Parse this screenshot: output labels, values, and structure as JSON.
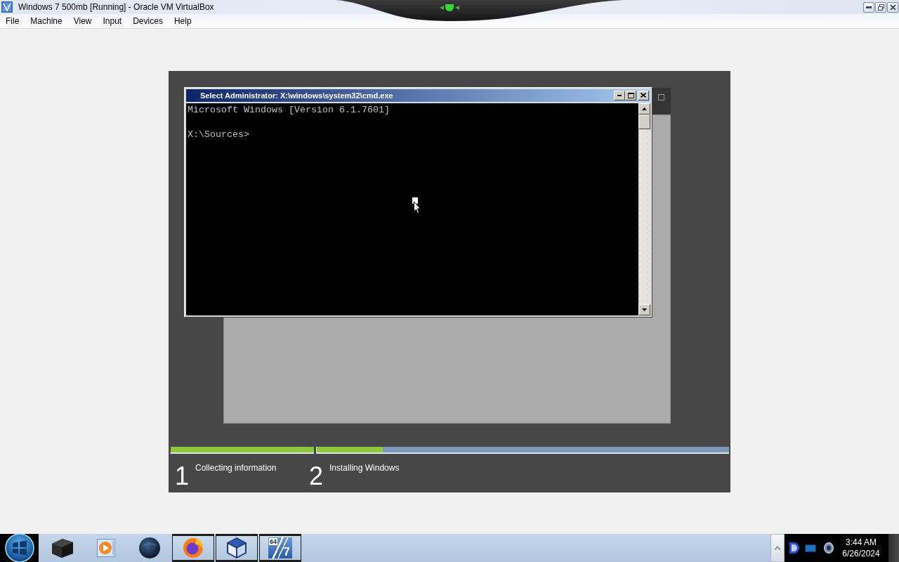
{
  "host_window": {
    "title": "Windows 7 500mb [Running] - Oracle VM VirtualBox"
  },
  "menu": [
    "File",
    "Machine",
    "View",
    "Input",
    "Devices",
    "Help"
  ],
  "guest": {
    "cmd_window": {
      "title": "Select Administrator: X:\\windows\\system32\\cmd.exe",
      "output": "Microsoft Windows [Version 6.1.7601]",
      "prompt": "X:\\Sources>"
    },
    "setup_steps": [
      {
        "number": "1",
        "label": "Collecting information",
        "level": 1
      },
      {
        "number": "2",
        "label": "Installing Windows",
        "level": 0.16
      }
    ]
  },
  "taskbar": {
    "buttons": [
      {
        "open": false
      },
      {
        "open": false
      },
      {
        "open": false
      },
      {
        "open": true
      },
      {
        "open": true
      },
      {
        "open": true,
        "logo_badge": "64",
        "logo_number": "7"
      }
    ],
    "clock": {
      "time": "3:44 AM",
      "date": "6/26/2024"
    }
  }
}
